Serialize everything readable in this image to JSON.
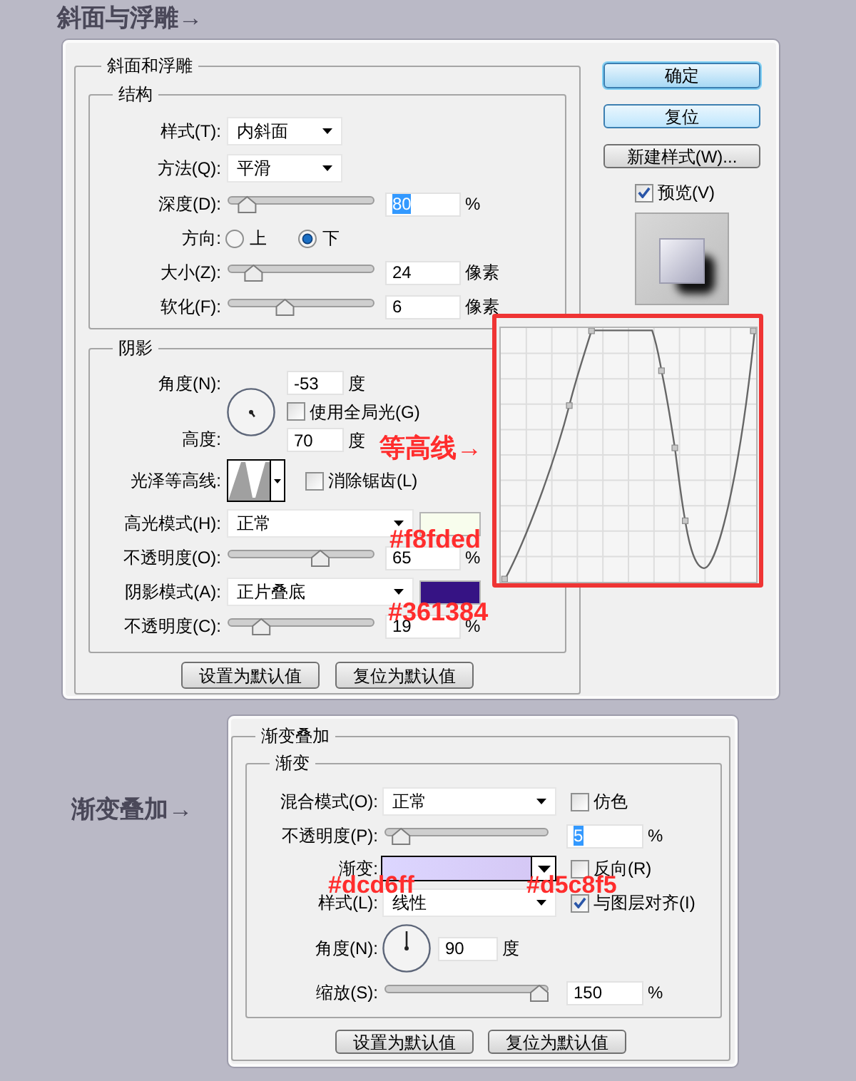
{
  "bevel_heading": "斜面与浮雕→",
  "bevel_dialog": {
    "title": "斜面和浮雕",
    "structure": {
      "title": "结构",
      "rows": [
        {
          "kind": "select",
          "label": "样式(T):",
          "value": "内斜面"
        },
        {
          "kind": "select",
          "label": "方法(Q):",
          "value": "平滑"
        },
        {
          "kind": "slider",
          "label": "深度(D):",
          "level": 0.08,
          "value": "80",
          "highlighted": true,
          "unit": "%"
        },
        {
          "kind": "radio",
          "label": "方向:",
          "options": [
            {
              "label": "上",
              "selected": false
            },
            {
              "label": "下",
              "selected": true
            }
          ]
        },
        {
          "kind": "slider",
          "label": "大小(Z):",
          "level": 0.13,
          "value": "24",
          "highlighted": false,
          "unit": "像素"
        },
        {
          "kind": "slider",
          "label": "软化(F):",
          "level": 0.375,
          "value": "6",
          "highlighted": false,
          "unit": "像素"
        }
      ]
    },
    "shading": {
      "title": "阴影",
      "rows": [
        {
          "kind": "angle",
          "label": "角度(N):",
          "value": "-53",
          "unit": "度",
          "global_light": {
            "label": "使用全局光(G)",
            "checked": false
          },
          "altitude": {
            "label": "高度:",
            "value": "70",
            "unit": "度"
          }
        },
        {
          "kind": "contour",
          "label": "光泽等高线:",
          "option": {
            "label": "消除锯齿(L)",
            "checked": false
          }
        },
        {
          "kind": "select",
          "label": "高光模式(H):",
          "value": "正常",
          "color": "#f8fded"
        },
        {
          "kind": "slider",
          "label": "不透明度(O):",
          "level": 0.65,
          "value": "65",
          "highlighted": false,
          "unit": "%"
        },
        {
          "kind": "select",
          "label": "阴影模式(A):",
          "value": "正片叠底",
          "color": "#361384"
        },
        {
          "kind": "slider",
          "label": "不透明度(C):",
          "level": 0.19,
          "value": "19",
          "highlighted": false,
          "unit": "%"
        }
      ]
    },
    "buttons": [
      "设置为默认值",
      "复位为默认值"
    ],
    "side_buttons": [
      {
        "label": "确定",
        "kind": "default"
      },
      {
        "label": "复位",
        "kind": "accent"
      },
      {
        "label": "新建样式(W)...",
        "kind": "plain"
      }
    ],
    "preview": {
      "label": "预览(V)",
      "checked": true
    }
  },
  "contour_callout": "等高线→",
  "shading_color_notes": [
    "#f8fded",
    "#361384"
  ],
  "gradient_heading": "渐变叠加→",
  "gradient_dialog": {
    "title": "渐变叠加",
    "group": {
      "title": "渐变",
      "rows": [
        {
          "kind": "select",
          "label": "混合模式(O):",
          "value": "正常",
          "option": {
            "label": "仿色",
            "checked": false
          }
        },
        {
          "kind": "slider",
          "label": "不透明度(P):",
          "level": 0.05,
          "value": "5",
          "highlighted": true,
          "unit": "%"
        },
        {
          "kind": "gradient",
          "label": "渐变:",
          "stops": [
            {
              "color": "#dcd6ff"
            },
            {
              "color": "#d5c8f5"
            }
          ],
          "option": {
            "label": "反向(R)",
            "checked": false
          }
        },
        {
          "kind": "select",
          "label": "样式(L):",
          "value": "线性",
          "option": {
            "label": "与图层对齐(I)",
            "checked": true
          }
        },
        {
          "kind": "angle",
          "label": "角度(N):",
          "value": "90",
          "unit": "度"
        },
        {
          "kind": "slider",
          "label": "缩放(S):",
          "level": 1.0,
          "value": "150",
          "highlighted": false,
          "unit": "%"
        }
      ]
    },
    "buttons": [
      "设置为默认值",
      "复位为默认值"
    ]
  },
  "gradient_color_notes": [
    "#dcd6ff",
    "#d5c8f5"
  ]
}
